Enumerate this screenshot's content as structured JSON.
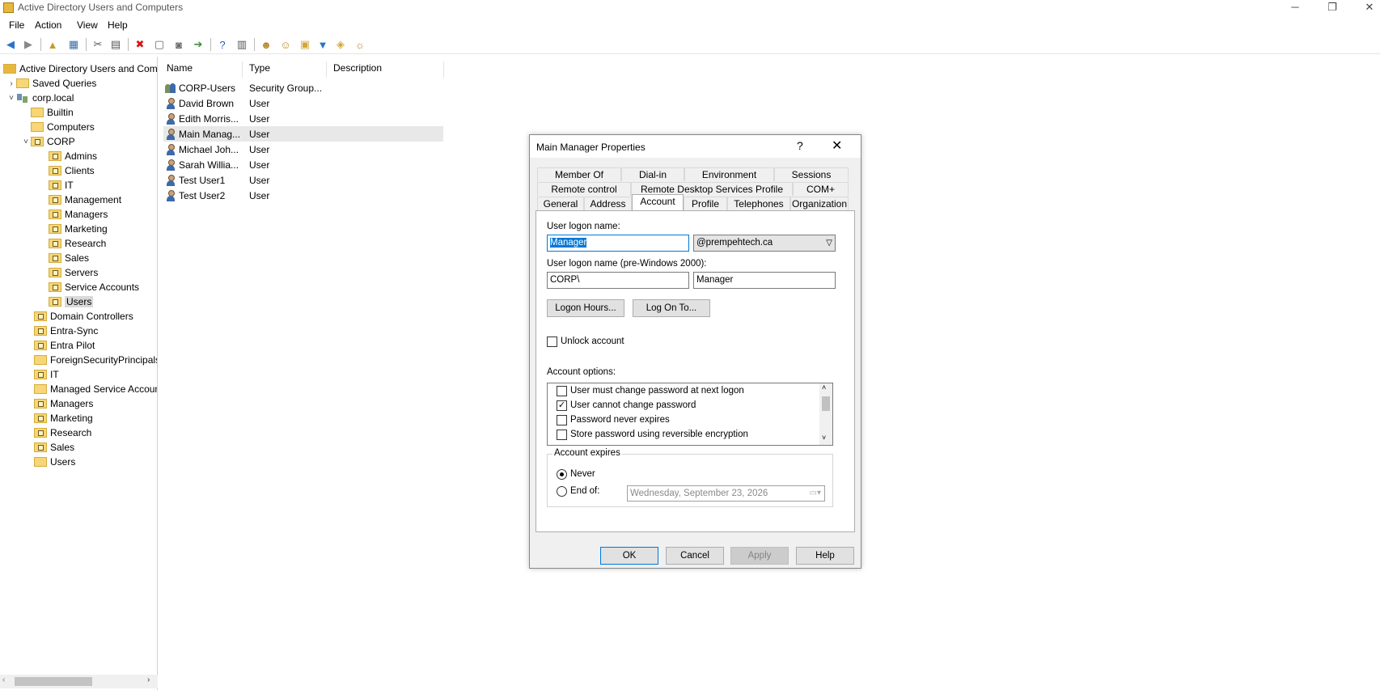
{
  "window": {
    "title": "Active Directory Users and Computers",
    "minimize": "─",
    "restore": "❐",
    "close": "✕"
  },
  "menu": [
    "File",
    "Action",
    "View",
    "Help"
  ],
  "toolbar": [
    "back-icon",
    "forward-icon",
    "up-folder-icon",
    "show-console-tree-icon",
    "cut-icon",
    "copy-icon",
    "delete-icon",
    "properties-icon",
    "refresh-icon",
    "export-list-icon",
    "help-icon",
    "console-view-icon",
    "new-user-icon",
    "new-group-icon",
    "new-ou-icon",
    "filter-icon",
    "find-icon",
    "add-to-group-icon"
  ],
  "tree": {
    "root": "Active Directory Users and Com",
    "saved_queries": "Saved Queries",
    "domain": "corp.local",
    "items": [
      {
        "label": "Builtin"
      },
      {
        "label": "Computers"
      },
      {
        "label": "CORP"
      },
      {
        "label": "Admins"
      },
      {
        "label": "Clients"
      },
      {
        "label": "IT"
      },
      {
        "label": "Management"
      },
      {
        "label": "Managers"
      },
      {
        "label": "Marketing"
      },
      {
        "label": "Research"
      },
      {
        "label": "Sales"
      },
      {
        "label": "Servers"
      },
      {
        "label": "Service Accounts"
      },
      {
        "label": "Users"
      },
      {
        "label": "Domain Controllers"
      },
      {
        "label": "Entra-Sync"
      },
      {
        "label": "Entra Pilot"
      },
      {
        "label": "ForeignSecurityPrincipals"
      },
      {
        "label": "IT"
      },
      {
        "label": "Managed Service Accoun"
      },
      {
        "label": "Managers"
      },
      {
        "label": "Marketing"
      },
      {
        "label": "Research"
      },
      {
        "label": "Sales"
      },
      {
        "label": "Users"
      }
    ]
  },
  "list": {
    "columns": [
      "Name",
      "Type",
      "Description"
    ],
    "rows": [
      {
        "name": "CORP-Users",
        "type": "Security Group..."
      },
      {
        "name": "David Brown",
        "type": "User"
      },
      {
        "name": "Edith Morris...",
        "type": "User"
      },
      {
        "name": "Main Manag...",
        "type": "User"
      },
      {
        "name": "Michael Joh...",
        "type": "User"
      },
      {
        "name": "Sarah Willia...",
        "type": "User"
      },
      {
        "name": "Test User1",
        "type": "User"
      },
      {
        "name": "Test User2",
        "type": "User"
      }
    ]
  },
  "dialog": {
    "title": "Main Manager Properties",
    "help": "?",
    "close": "✕",
    "tabs_row1": [
      "Member Of",
      "Dial-in",
      "Environment",
      "Sessions"
    ],
    "tabs_row2": [
      "Remote control",
      "Remote Desktop Services Profile",
      "COM+"
    ],
    "tabs_row3": [
      "General",
      "Address",
      "Account",
      "Profile",
      "Telephones",
      "Organization"
    ],
    "logon_name_label": "User logon name:",
    "logon_name_value": "Manager",
    "upn_suffix": "@prempehtech.ca",
    "pre2000_label": "User logon name (pre-Windows 2000):",
    "pre2000_domain": "CORP\\",
    "pre2000_name": "Manager",
    "logon_hours_button": "Logon Hours...",
    "log_on_to_button": "Log On To...",
    "unlock_label": "Unlock account",
    "account_options_label": "Account options:",
    "account_options": [
      {
        "label": "User must change password at next logon",
        "checked": false
      },
      {
        "label": "User cannot change password",
        "checked": true
      },
      {
        "label": "Password never expires",
        "checked": false
      },
      {
        "label": "Store password using reversible encryption",
        "checked": false
      }
    ],
    "account_expires_label": "Account expires",
    "never_label": "Never",
    "end_of_label": "End of:",
    "end_of_date": "Wednesday,  September 23, 2026",
    "ok": "OK",
    "cancel": "Cancel",
    "apply": "Apply",
    "help_button": "Help"
  }
}
